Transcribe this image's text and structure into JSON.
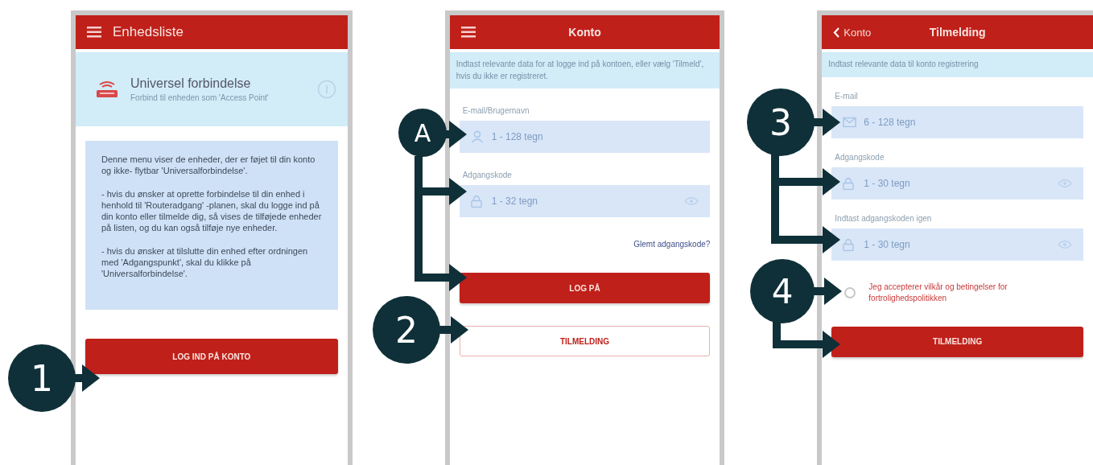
{
  "screens": [
    {
      "header": {
        "kind": "menu",
        "title": "Enhedsliste"
      },
      "banner": {
        "title": "Universel forbindelse",
        "subtitle": "Forbind til enheden som 'Access Point'"
      },
      "note": [
        "Denne menu viser de enheder, der er føjet til din konto og ikke- flytbar 'Universalforbindelse'.",
        "- hvis du ønsker at oprette forbindelse til din enhed i henhold til 'Routeradgang' -planen, skal du logge ind på din konto eller tilmelde dig, så vises de tilføjede enheder på listen, og du kan også tilføje nye enheder.",
        "- hvis du ønsker at tilslutte din enhed efter ordningen med 'Adgangspunkt', skal du klikke på 'Universalforbindelse'."
      ],
      "buttons": [
        {
          "label": "LOG IND PÅ KONTO",
          "kind": "primary"
        }
      ]
    },
    {
      "header": {
        "kind": "menu-centered",
        "title": "Konto"
      },
      "info": "Indtast relevante data for at logge ind på kontoen, eller vælg 'Tilmeld', hvis du ikke er registreret.",
      "fields": [
        {
          "label": "E-mail/Brugernavn",
          "placeholder": "1 - 128 tegn",
          "kind": "username"
        },
        {
          "label": "Adgangskode",
          "placeholder": "1 - 32 tegn",
          "kind": "password"
        }
      ],
      "link": "Glemt adgangskode?",
      "buttons": [
        {
          "label": "LOG PÅ",
          "kind": "primary"
        },
        {
          "label": "TILMELDING",
          "kind": "outline"
        }
      ]
    },
    {
      "header": {
        "kind": "back",
        "back_label": "Konto",
        "title": "Tilmelding"
      },
      "info": "Indtast relevante data til konto registrering",
      "fields": [
        {
          "label": "E-mail",
          "placeholder": "6 - 128 tegn",
          "kind": "email"
        },
        {
          "label": "Adgangskode",
          "placeholder": "1 - 30 tegn",
          "kind": "password"
        },
        {
          "label": "Indtast adgangskoden igen",
          "placeholder": "1 - 30 tegn",
          "kind": "password"
        }
      ],
      "consent": {
        "text": "Jeg accepterer vilkår og betingelser for fortrolighedspolitikken",
        "checked": false
      },
      "buttons": [
        {
          "label": "TILMELDING",
          "kind": "primary"
        }
      ]
    }
  ],
  "callouts": [
    {
      "label": "1"
    },
    {
      "label": "A"
    },
    {
      "label": "2"
    },
    {
      "label": "3"
    },
    {
      "label": "4"
    }
  ]
}
